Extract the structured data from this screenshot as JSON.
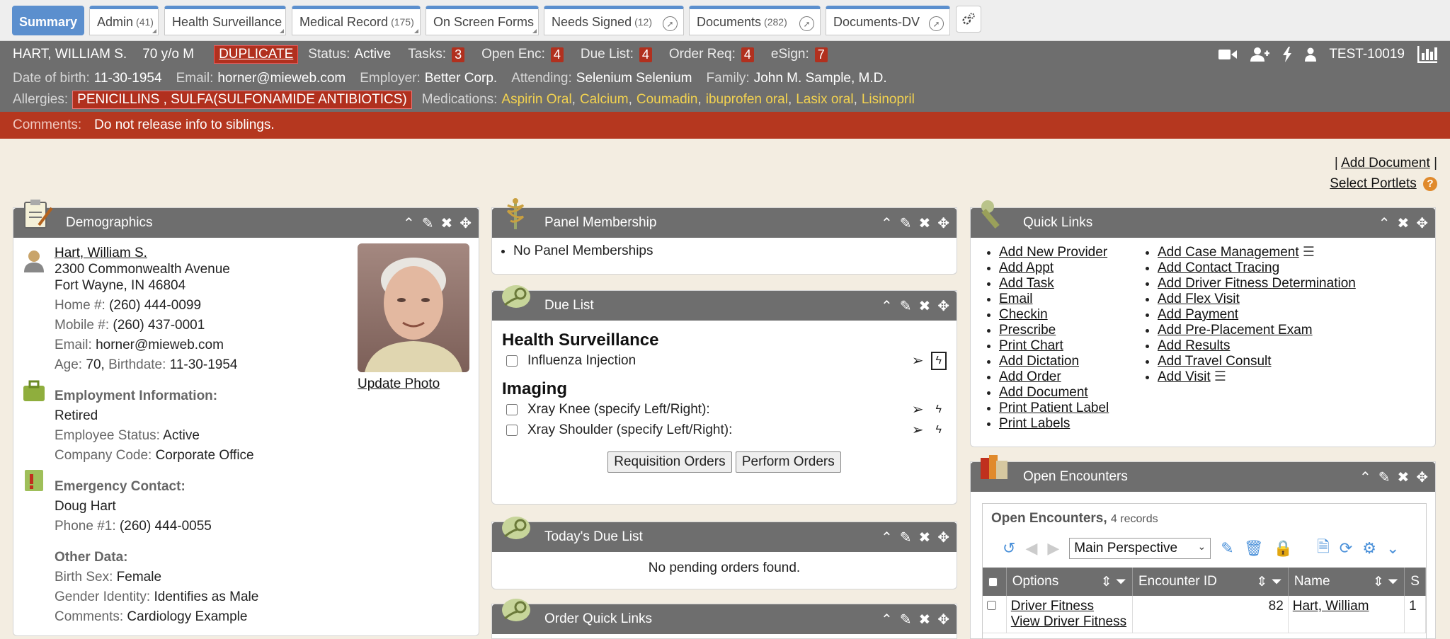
{
  "tabs": [
    {
      "label": "Summary",
      "count": "",
      "active": true
    },
    {
      "label": "Admin",
      "count": "(41)"
    },
    {
      "label": "Health Surveillance",
      "count": ""
    },
    {
      "label": "Medical Record",
      "count": "(175)"
    },
    {
      "label": "On Screen Forms",
      "count": ""
    },
    {
      "label": "Needs Signed",
      "count": "(12)"
    },
    {
      "label": "Documents",
      "count": "(282)"
    },
    {
      "label": "Documents-DV",
      "count": ""
    }
  ],
  "patient": {
    "name": "HART, WILLIAM S.",
    "age_sex": "70 y/o M",
    "duplicate": "DUPLICATE",
    "status_label": "Status:",
    "status": "Active",
    "tasks_label": "Tasks:",
    "tasks": "3",
    "open_enc_label": "Open Enc:",
    "open_enc": "4",
    "due_list_label": "Due List:",
    "due_list": "4",
    "order_req_label": "Order Req:",
    "order_req": "4",
    "esign_label": "eSign:",
    "esign": "7",
    "account": "TEST-10019",
    "dob_label": "Date of birth:",
    "dob": "11-30-1954",
    "email_label": "Email:",
    "email": "horner@mieweb.com",
    "employer_label": "Employer:",
    "employer": "Better Corp.",
    "attending_label": "Attending:",
    "attending": "Selenium Selenium",
    "family_label": "Family:",
    "family": "John M. Sample, M.D.",
    "allergies_label": "Allergies:",
    "allergies": "PENICILLINS , SULFA(SULFONAMIDE ANTIBIOTICS)",
    "medications_label": "Medications:",
    "medications": [
      "Aspirin Oral",
      "Calcium",
      "Coumadin",
      "ibuprofen oral",
      "Lasix oral",
      "Lisinopril"
    ],
    "comments_label": "Comments:",
    "comments": "Do not release info to siblings."
  },
  "toplinks": {
    "sep1": "|",
    "add_document": "Add Document",
    "sep2": "|",
    "select_portlets": "Select Portlets"
  },
  "demographics": {
    "title": "Demographics",
    "name": "Hart, William S.",
    "address1": "2300 Commonwealth Avenue",
    "address2": "Fort Wayne, IN 46804",
    "home_label": "Home #:",
    "home": "(260) 444-0099",
    "mobile_label": "Mobile #:",
    "mobile": "(260) 437-0001",
    "email_label": "Email:",
    "email": "horner@mieweb.com",
    "age_label": "Age:",
    "age": "70,",
    "birthdate_label": "Birthdate:",
    "birthdate": "11-30-1954",
    "update_photo": "Update Photo",
    "emp_header": "Employment Information:",
    "emp_status_text": "Retired",
    "emp_status_label": "Employee Status:",
    "emp_status": "Active",
    "company_label": "Company Code:",
    "company": "Corporate Office",
    "ec_header": "Emergency Contact:",
    "ec_name": "Doug Hart",
    "ec_phone_label": "Phone #1:",
    "ec_phone": "(260) 444-0055",
    "other_header": "Other Data:",
    "sex_label": "Birth Sex:",
    "sex": "Female",
    "gender_label": "Gender Identity:",
    "gender": "Identifies as Male",
    "comments_label": "Comments:",
    "comments": "Cardiology Example"
  },
  "panel": {
    "title": "Panel Membership",
    "item": "No Panel Memberships"
  },
  "due_list": {
    "title": "Due List",
    "sections": [
      {
        "header": "Health Surveillance",
        "items": [
          "Influenza Injection"
        ]
      },
      {
        "header": "Imaging",
        "items": [
          "Xray Knee (specify Left/Right):",
          "Xray Shoulder (specify Left/Right):"
        ]
      }
    ],
    "req_btn": "Requisition Orders",
    "perf_btn": "Perform Orders"
  },
  "todays_due": {
    "title": "Today's Due List",
    "text": "No pending orders found."
  },
  "order_quick": {
    "title": "Order Quick Links"
  },
  "quick_links": {
    "title": "Quick Links",
    "col1": [
      "Add New Provider",
      "Add Appt",
      "Add Task",
      "Email",
      "Checkin",
      "Prescribe",
      "Print Chart",
      "Add Dictation",
      "Add Order",
      "Add Document",
      "Print Patient Label",
      "Print Labels"
    ],
    "col2": [
      "Add Case Management",
      "Add Contact Tracing",
      "Add Driver Fitness Determination",
      "Add Flex Visit",
      "Add Payment",
      "Add Pre-Placement Exam",
      "Add Results",
      "Add Travel Consult",
      "Add Visit"
    ]
  },
  "encounters": {
    "title": "Open Encounters",
    "subtitle": "Open Encounters,",
    "records": "4 records",
    "perspective": "Main Perspective",
    "cols": [
      "Options",
      "Encounter ID",
      "Name",
      "S"
    ],
    "row": {
      "opt1": "Driver Fitness",
      "opt2": "View Driver Fitness",
      "id": "82",
      "name": "Hart, William",
      "s": "1"
    }
  },
  "colors": {
    "accent": "#5b8fce",
    "header": "#6e6e6e",
    "alert": "#b1301e",
    "background": "#f3ede1",
    "med": "#f2d250"
  }
}
